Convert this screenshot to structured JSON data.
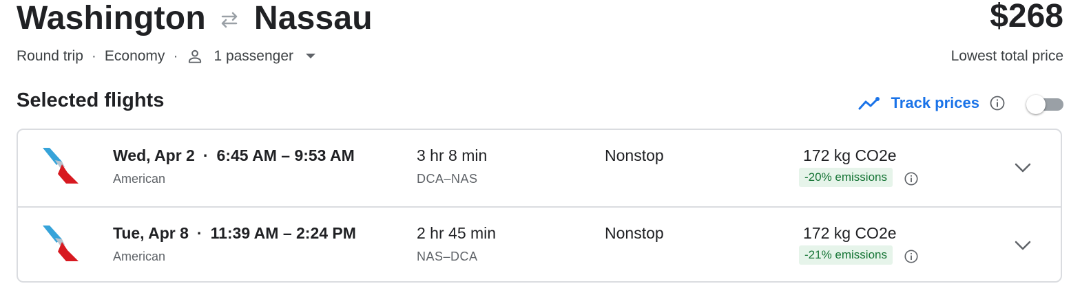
{
  "header": {
    "origin": "Washington",
    "destination": "Nassau",
    "price": "$268",
    "price_caption": "Lowest total price"
  },
  "trip": {
    "type": "Round trip",
    "cabin": "Economy",
    "passengers": "1 passenger",
    "separator": "·"
  },
  "selected": {
    "title": "Selected flights",
    "track_label": "Track prices",
    "track_enabled": false
  },
  "flights": [
    {
      "date": "Wed, Apr 2",
      "times": "6:45 AM – 9:53 AM",
      "airline": "American",
      "duration": "3 hr 8 min",
      "airports": "DCA–NAS",
      "stops": "Nonstop",
      "emissions": "172 kg CO2e",
      "emissions_delta": "-20% emissions"
    },
    {
      "date": "Tue, Apr 8",
      "times": "11:39 AM – 2:24 PM",
      "airline": "American",
      "duration": "2 hr 45 min",
      "airports": "NAS–DCA",
      "stops": "Nonstop",
      "emissions": "172 kg CO2e",
      "emissions_delta": "-21% emissions"
    }
  ],
  "icons": {
    "swap": "swap-arrows-icon",
    "passenger": "person-icon",
    "dropdown": "caret-down-icon",
    "track": "trend-line-icon",
    "info": "info-icon",
    "expand": "chevron-down-icon",
    "airline_logo": "american-airlines-logo"
  },
  "colors": {
    "accent": "#1a73e8",
    "text_primary": "#202124",
    "text_secondary": "#5f6368",
    "border": "#dadce0",
    "emissions_bg": "#e6f4ea",
    "emissions_text": "#137333"
  }
}
